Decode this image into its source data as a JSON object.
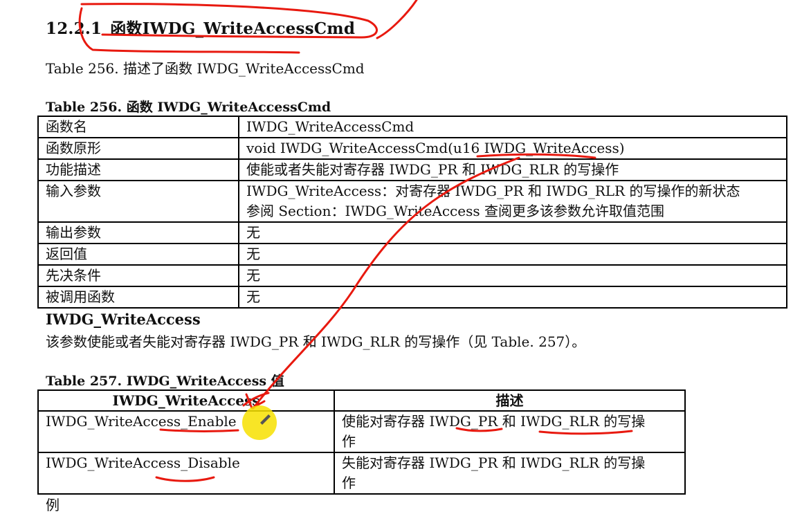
{
  "section": {
    "number": "12.2.1",
    "title": "函数IWDG_WriteAccessCmd"
  },
  "intro": "Table 256. 描述了函数 IWDG_WriteAccessCmd",
  "table256": {
    "caption": "Table 256. 函数 IWDG_WriteAccessCmd",
    "rows": [
      {
        "key": "函数名",
        "value": "IWDG_WriteAccessCmd"
      },
      {
        "key": "函数原形",
        "value": "void IWDG_WriteAccessCmd(u16 IWDG_WriteAccess)"
      },
      {
        "key": "功能描述",
        "value": "使能或者失能对寄存器 IWDG_PR 和 IWDG_RLR 的写操作"
      },
      {
        "key": "输入参数",
        "value": "IWDG_WriteAccess：对寄存器 IWDG_PR 和 IWDG_RLR 的写操作的新状态",
        "value2": "参阅 Section：IWDG_WriteAccess 查阅更多该参数允许取值范围"
      },
      {
        "key": "输出参数",
        "value": "无"
      },
      {
        "key": "返回值",
        "value": "无"
      },
      {
        "key": "先决条件",
        "value": "无"
      },
      {
        "key": "被调用函数",
        "value": "无"
      }
    ]
  },
  "param_section": {
    "title": "IWDG_WriteAccess",
    "text": "该参数使能或者失能对寄存器 IWDG_PR 和 IWDG_RLR 的写操作（见 Table. 257）。"
  },
  "table257": {
    "caption": "Table 257. IWDG_WriteAccess 值",
    "headers": [
      "IWDG_WriteAccess",
      "描述"
    ],
    "rows": [
      {
        "value": "IWDG_WriteAccess_Enable",
        "desc": "使能对寄存器 IWDG_PR 和 IWDG_RLR 的写操",
        "desc2": "作"
      },
      {
        "value": "IWDG_WriteAccess_Disable",
        "desc": "失能对寄存器 IWDG_PR 和 IWDG_RLR 的写操",
        "desc2": "作"
      }
    ]
  },
  "cut_text": "例",
  "colors": {
    "annotation_red": "#e8190f",
    "cursor_yellow": "#f7e000"
  }
}
